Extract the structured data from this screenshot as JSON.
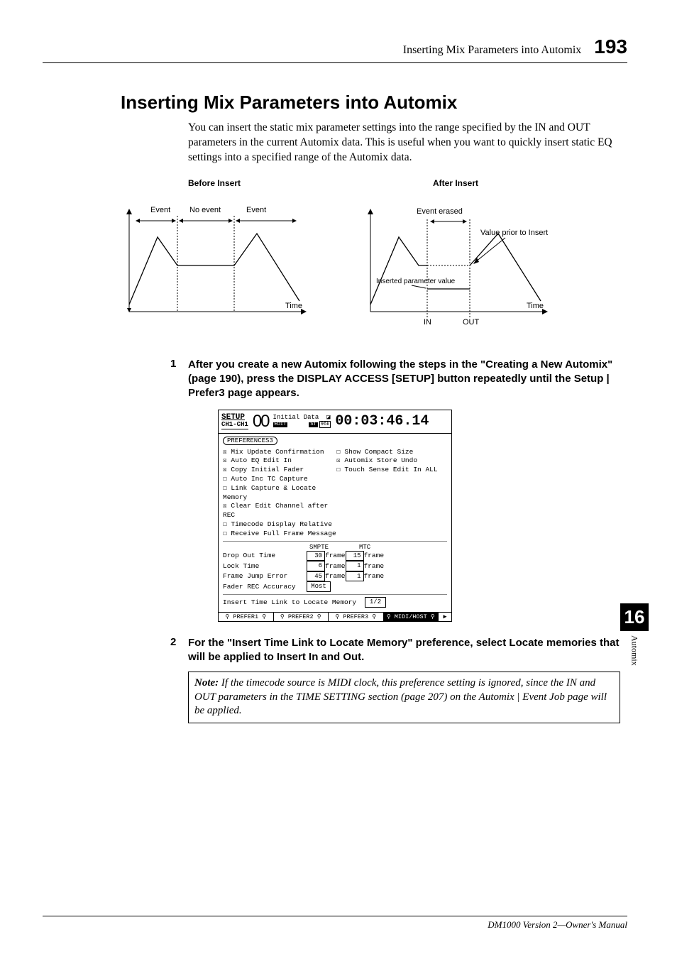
{
  "header": {
    "title": "Inserting Mix Parameters into Automix",
    "page": "193"
  },
  "section_title": "Inserting Mix Parameters into Automix",
  "intro_paragraph": "You can insert the static mix parameter settings into the range specified by the IN and OUT parameters in the current Automix data. This is useful when you want to quickly insert static EQ settings into a specified range of the Automix data.",
  "diagram": {
    "before": {
      "caption": "Before Insert",
      "labels": {
        "event1": "Event",
        "noevent": "No event",
        "event2": "Event",
        "time": "Time"
      }
    },
    "after": {
      "caption": "After Insert",
      "labels": {
        "event_erased": "Event erased",
        "value_prior": "Value prior to Insert",
        "inserted": "Inserted parameter value",
        "time": "Time",
        "in": "IN",
        "out": "OUT"
      }
    }
  },
  "steps": [
    {
      "num": "1",
      "text": "After you create a new Automix following the steps in the \"Creating a New Automix\" (page 190), press the DISPLAY ACCESS [SETUP] button repeatedly until the Setup | Prefer3 page appears."
    },
    {
      "num": "2",
      "text": "For the \"Insert Time Link to Locate Memory\" preference, select Locate memories that will be applied to Insert In and Out."
    }
  ],
  "screenshot": {
    "setup": "SETUP",
    "ch": "CH1-CH1",
    "big": "00",
    "edit": "EDIT",
    "mid1": "Initial Data",
    "lock": "◪",
    "st": "ST",
    "khz": "96k",
    "time": "00:03:46.14",
    "pref_btn": "PREFERENCES3",
    "rows_left": [
      "☒ Mix Update Confirmation",
      "☒ Auto EQ Edit In",
      "☒ Copy Initial Fader",
      "☐ Auto Inc TC Capture",
      "☐ Link Capture & Locate Memory",
      "☒ Clear Edit Channel after REC",
      "☐ Timecode Display Relative",
      "☐ Receive Full Frame Message"
    ],
    "rows_right": [
      "☐ Show Compact Size",
      "☒ Automix Store Undo",
      "☐ Touch Sense Edit In ALL",
      "",
      "",
      "",
      "",
      ""
    ],
    "col_smpte": "SMPTE",
    "col_mtc": "MTC",
    "valrows": [
      {
        "lab": "Drop Out Time",
        "v1": "30",
        "u1": "frame",
        "v2": "15",
        "u2": "frame"
      },
      {
        "lab": "Lock Time",
        "v1": "6",
        "u1": "frame",
        "v2": "1",
        "u2": "frame"
      },
      {
        "lab": "Frame Jump Error",
        "v1": "45",
        "u1": "frame",
        "v2": "1",
        "u2": "frame"
      }
    ],
    "fader_row": {
      "lab": "Fader REC Accuracy",
      "val": "Most"
    },
    "insert_row": {
      "lab": "Insert Time Link to Locate Memory",
      "val": "1/2"
    },
    "tabs": [
      "PREFER1",
      "PREFER2",
      "PREFER3",
      "MIDI/HOST",
      "▶"
    ]
  },
  "note": {
    "label": "Note:",
    "text": "If the timecode source is MIDI clock, this preference setting is ignored, since the IN and OUT parameters in the TIME SETTING section (page 207) on the Automix | Event Job page will be applied."
  },
  "side": {
    "num": "16",
    "label": "Automix"
  },
  "footer": "DM1000 Version 2—Owner's Manual"
}
